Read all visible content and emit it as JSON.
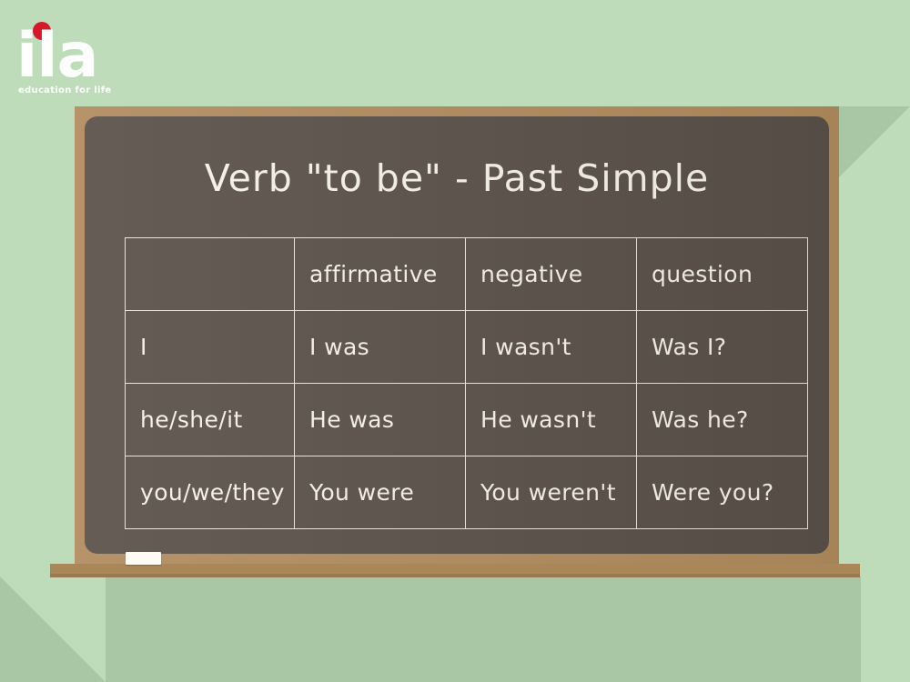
{
  "page": {
    "background_color": "#bedcb9",
    "board_color": "#5a5049",
    "frame_color": "#b08b5d",
    "ledge_color": "#a98758",
    "chalk_color": "#f4f1e8"
  },
  "logo": {
    "wordmark": "ila",
    "tagline": "education for life",
    "dot_color": "#d7182a",
    "text_color": "#ffffff"
  },
  "board": {
    "title": "Verb \"to be\" - Past Simple",
    "chalk_piece_label": "chalk"
  },
  "table": {
    "headers": [
      "",
      "affirmative",
      "negative",
      "question"
    ],
    "rows": [
      {
        "pronoun": "I",
        "affirmative": "I was",
        "negative": "I wasn't",
        "question": "Was I?"
      },
      {
        "pronoun": "he/she/it",
        "affirmative": "He was",
        "negative": "He wasn't",
        "question": "Was he?"
      },
      {
        "pronoun": "you/we/they",
        "affirmative": "You were",
        "negative": "You weren't",
        "question": "Were you?"
      }
    ]
  }
}
